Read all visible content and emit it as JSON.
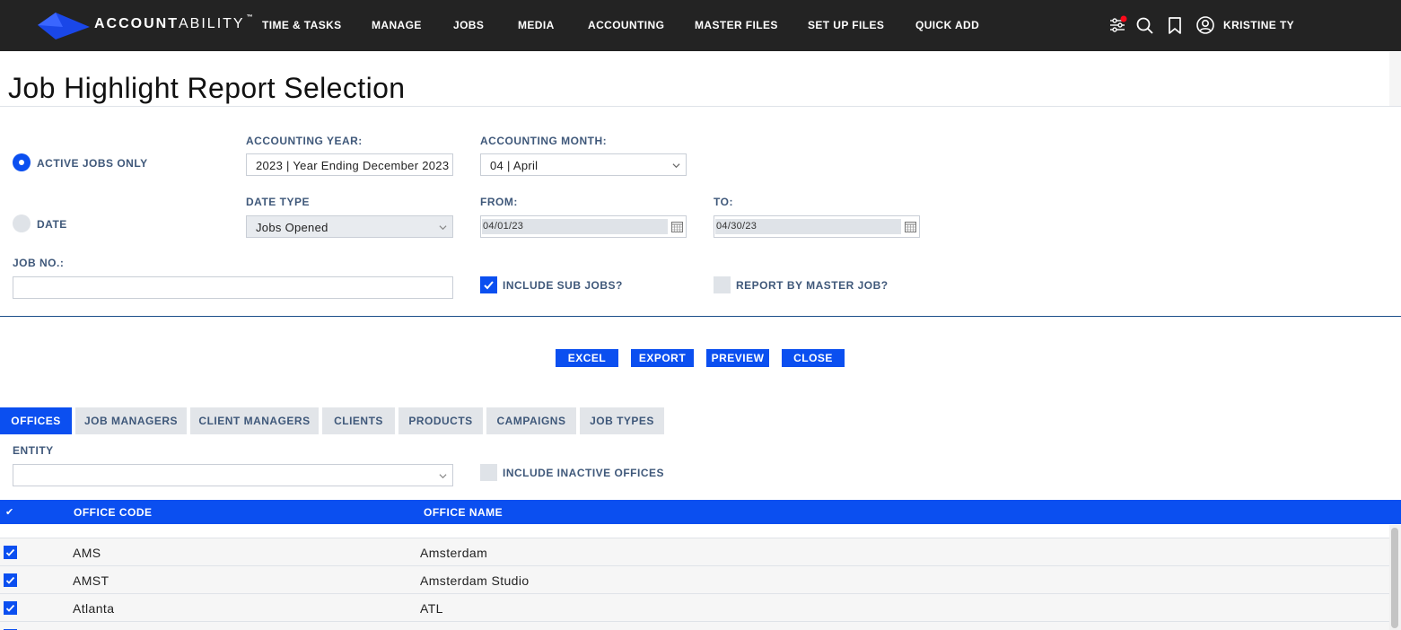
{
  "brand": {
    "name_bold": "ACCOUNT",
    "name_light": "ABILITY",
    "trademark": "™"
  },
  "nav": [
    "TIME & TASKS",
    "MANAGE",
    "JOBS",
    "MEDIA",
    "ACCOUNTING",
    "MASTER FILES",
    "SET UP FILES",
    "QUICK ADD"
  ],
  "user": {
    "name": "KRISTINE TY"
  },
  "icons": [
    "filter-settings-icon",
    "search-icon",
    "bookmark-icon",
    "user-icon",
    "notification-dot"
  ],
  "colors": {
    "topbar": "#232323",
    "accent": "#0b4ff0",
    "label": "#3f587a",
    "notification": "#ff0a1a"
  },
  "page": {
    "title": "Job Highlight Report Selection"
  },
  "form": {
    "active_jobs_only": {
      "label": "ACTIVE JOBS ONLY",
      "selected": true
    },
    "date_option": {
      "label": "DATE",
      "selected": false
    },
    "accounting_year": {
      "label": "ACCOUNTING YEAR:",
      "value": "2023 | Year Ending December 2023"
    },
    "accounting_month": {
      "label": "ACCOUNTING MONTH:",
      "value": "04 | April"
    },
    "date_type": {
      "label": "DATE TYPE",
      "value": "Jobs Opened"
    },
    "from": {
      "label": "FROM:",
      "value": "04/01/23"
    },
    "to": {
      "label": "TO:",
      "value": "04/30/23"
    },
    "job_no": {
      "label": "JOB NO.:",
      "value": ""
    },
    "include_sub_jobs": {
      "label": "INCLUDE SUB JOBS?",
      "checked": true
    },
    "report_by_master_job": {
      "label": "REPORT BY MASTER JOB?",
      "checked": false
    }
  },
  "buttons": {
    "excel": "EXCEL",
    "export": "EXPORT",
    "preview": "PREVIEW",
    "close": "CLOSE"
  },
  "tabs": [
    {
      "label": "OFFICES",
      "active": true
    },
    {
      "label": "JOB MANAGERS",
      "active": false
    },
    {
      "label": "CLIENT MANAGERS",
      "active": false
    },
    {
      "label": "CLIENTS",
      "active": false
    },
    {
      "label": "PRODUCTS",
      "active": false
    },
    {
      "label": "CAMPAIGNS",
      "active": false
    },
    {
      "label": "JOB TYPES",
      "active": false
    }
  ],
  "offices_tab": {
    "entity": {
      "label": "ENTITY",
      "value": ""
    },
    "include_inactive": {
      "label": "INCLUDE INACTIVE OFFICES",
      "checked": false
    },
    "columns": {
      "select": "✔",
      "code": "OFFICE CODE",
      "name": "OFFICE NAME"
    },
    "rows": [
      {
        "checked": true,
        "code": "AMS",
        "name": "Amsterdam"
      },
      {
        "checked": true,
        "code": "AMST",
        "name": "Amsterdam Studio"
      },
      {
        "checked": true,
        "code": "Atlanta",
        "name": "ATL"
      }
    ]
  }
}
